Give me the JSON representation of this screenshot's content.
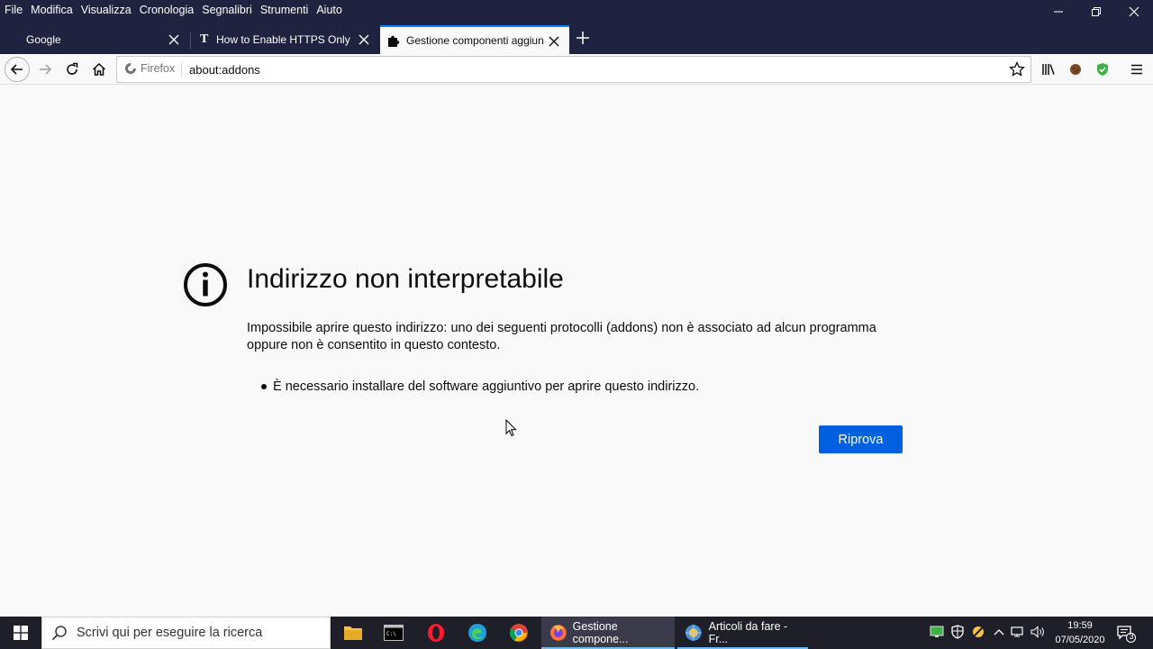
{
  "menubar": {
    "items": [
      "File",
      "Modifica",
      "Visualizza",
      "Cronologia",
      "Segnalibri",
      "Strumenti",
      "Aiuto"
    ]
  },
  "tabs": [
    {
      "label": "Google",
      "selected": false
    },
    {
      "label": "How to Enable HTTPS Only Mo",
      "selected": false
    },
    {
      "label": "Gestione componenti aggiunti",
      "selected": true
    }
  ],
  "navbar": {
    "identity_label": "Firefox",
    "url": "about:addons"
  },
  "error_page": {
    "title": "Indirizzo non interpretabile",
    "description": "Impossibile aprire questo indirizzo: uno dei seguenti protocolli (addons) non è associato ad alcun programma oppure non è consentito in questo contesto.",
    "bullets": [
      "È necessario installare del software aggiuntivo per aprire questo indirizzo."
    ],
    "retry_label": "Riprova"
  },
  "taskbar": {
    "search_placeholder": "Scrivi qui per eseguire la ricerca",
    "apps": [
      {
        "label": "Gestione compone...",
        "active": true
      },
      {
        "label": "Articoli da fare - Fr...",
        "active": false
      }
    ],
    "clock_time": "19:59",
    "clock_date": "07/05/2020",
    "notification_count": "3"
  },
  "colors": {
    "titlebar": "#202340",
    "tab_accent": "#0a84ff",
    "primary_button": "#0060df",
    "page_background": "#f9f9fa",
    "taskbar": "#1f1f2a"
  }
}
